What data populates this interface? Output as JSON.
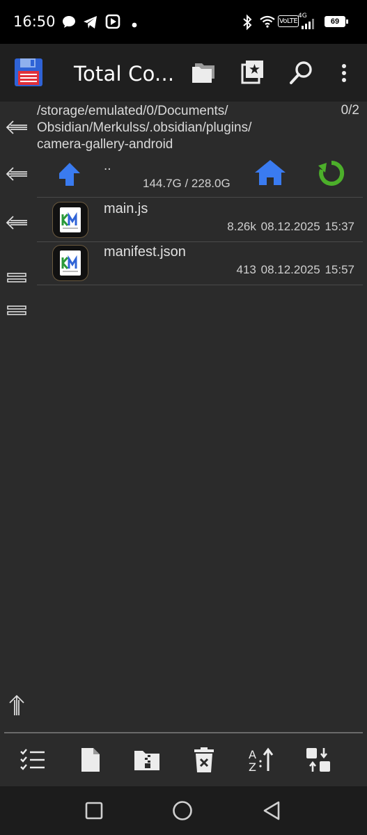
{
  "status_bar": {
    "time": "16:50",
    "network_label": "VoLTE",
    "network_gen": "4G",
    "battery": "69",
    "left_icons": [
      "chat-bubble-icon",
      "telegram-icon",
      "youtube-icon",
      "dot-icon"
    ],
    "right_icons": [
      "bluetooth-icon",
      "wifi-icon",
      "signal-icon",
      "battery-icon"
    ]
  },
  "title_bar": {
    "app_title": "Total Co...",
    "icons": [
      "floppy-disk-icon",
      "folders-icon",
      "bookmark-star-icon",
      "search-icon",
      "more-vert-icon"
    ]
  },
  "path": {
    "text": "/storage/emulated/0/Documents/\nObsidian/Merkulss/.obsidian/plugins/\ncamera-gallery-android",
    "line1": "/storage/emulated/0/Documents/",
    "line2": "Obsidian/Merkulss/.obsidian/plugins/",
    "line3": "camera-gallery-android",
    "selection_count": "0/2"
  },
  "parent_row": {
    "name": "..",
    "space": "144.7G / 228.0G"
  },
  "files": [
    {
      "name": "main.js",
      "size": "8.26k",
      "date": "08.12.2025",
      "time": "15:37"
    },
    {
      "name": "manifest.json",
      "size": "413",
      "date": "08.12.2025",
      "time": "15:57"
    }
  ],
  "colors": {
    "background": "#2b2b2b",
    "title_bar": "#1f1f1f",
    "accent_blue": "#3a7bf0",
    "accent_green": "#4caf2a",
    "floppy_red": "#e0303a"
  },
  "toolbar": {
    "icons": [
      "multi-select-icon",
      "new-file-icon",
      "zip-folder-icon",
      "delete-icon",
      "sort-az-icon",
      "swap-panels-icon"
    ]
  },
  "nav_bar": {
    "icons": [
      "recents-square-icon",
      "home-circle-icon",
      "back-triangle-icon"
    ]
  }
}
